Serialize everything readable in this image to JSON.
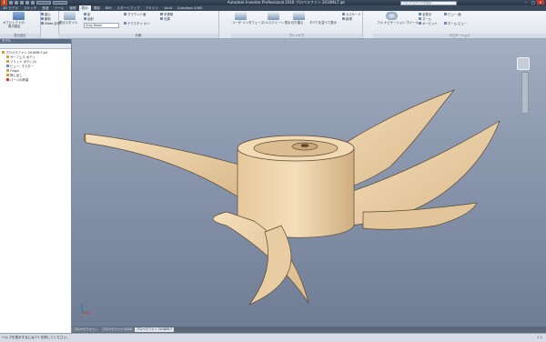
{
  "window": {
    "title": "Autodesk Inventor Professional 2016  プロペラファン 2016ML7.ipt",
    "help_search_placeholder": "ヘルプ/コマンドを検索...",
    "app_letter": "I"
  },
  "tabs": [
    "3D モデル",
    "スケッチ",
    "検査",
    "ツール",
    "管理",
    "表示",
    "環境",
    "BIM",
    "スタートアップ",
    "アドイン",
    "Vault",
    "Autodesk A360"
  ],
  "active_tab": "表示",
  "ribbon": {
    "groups": [
      {
        "title": "表示設定",
        "items": [
          "オブジェクトの",
          "表示設定",
          "重心",
          "解析",
          "iMate 記号"
        ]
      },
      {
        "title": "外観",
        "items": [
          "表示スタイル",
          "影",
          "反射",
          "グラウンド面",
          "テクスチャ オン",
          "Gray Room",
          "半透明",
          "光源"
        ]
      },
      {
        "title": "ウィンドウ",
        "items": [
          "ユーザ インタフェース",
          "フルスクリーン 表示",
          "切り替え",
          "すべてを並べて表示",
          "カスケード",
          "新規"
        ]
      },
      {
        "title": "ナビゲーション",
        "items": [
          "フル ナビゲーション ホイール",
          "全表示",
          "ズーム",
          "オービット",
          "ビュー 面",
          "ホーム ビュー"
        ]
      }
    ],
    "appearance_combo": "Gray Room"
  },
  "browser": {
    "title": "モデル",
    "items": [
      {
        "label": "プロペラファン 2016ML7.ipt",
        "icon": "part-icon",
        "color": "#d89a2a"
      },
      {
        "label": "サーフェス ボディ",
        "icon": "folder-icon",
        "color": "#c9a34a"
      },
      {
        "label": "ソリッド ボディ(1)",
        "icon": "folder-icon",
        "color": "#c9a34a"
      },
      {
        "label": "ビュー: マスター",
        "icon": "view-icon",
        "color": "#6f8fb0"
      },
      {
        "label": "Origin",
        "icon": "folder-icon",
        "color": "#c9a34a"
      },
      {
        "label": "押し出し",
        "icon": "extrude-icon",
        "color": "#d89a2a"
      },
      {
        "label": "パーツの終端",
        "icon": "end-of-part-icon",
        "color": "#d23a2a"
      }
    ]
  },
  "doc_tabs": [
    "プロペラファン...",
    "プロペラファン 2016",
    "プロペラファン 2016ML7"
  ],
  "active_doc_tab": "プロペラファン 2016ML7",
  "status": {
    "text": "ヘルプを表示するには F1 を押してください。",
    "right": "1   1"
  },
  "colors": {
    "part": "#f1d8b0",
    "part_shade": "#d9b98c",
    "part_dark": "#a8865a",
    "viewport_top": "#a4aec2",
    "viewport_bottom": "#6f7d95"
  }
}
